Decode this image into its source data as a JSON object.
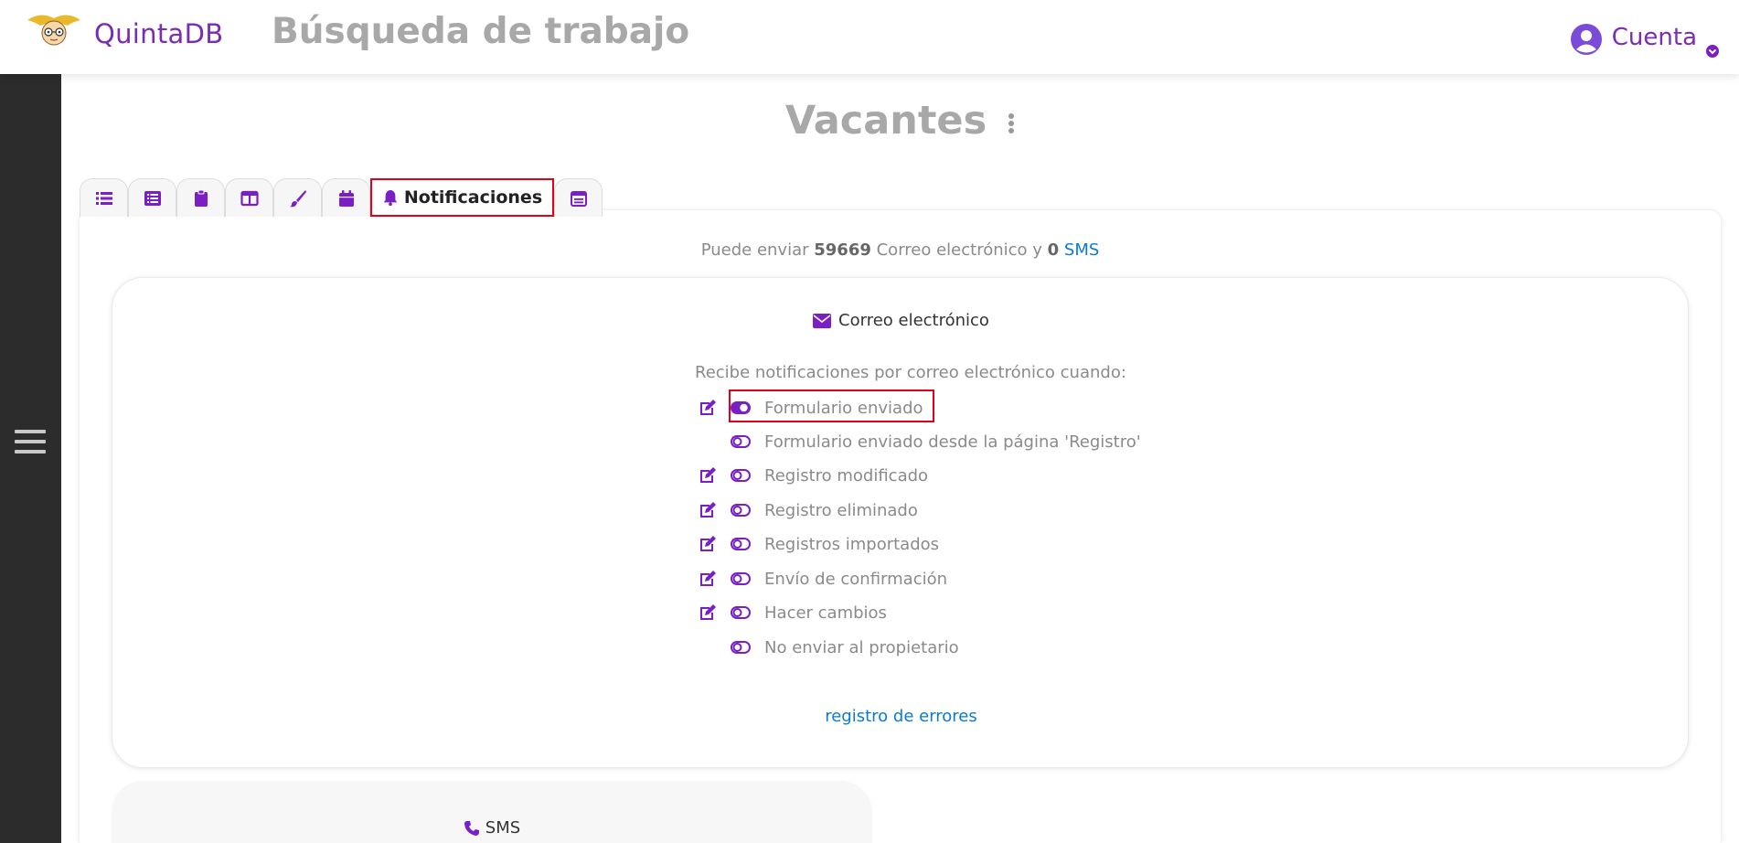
{
  "header": {
    "brand": "QuintaDB",
    "page_title": "Búsqueda de trabajo",
    "account_label": "Cuenta"
  },
  "section": {
    "title": "Vacantes"
  },
  "tabs": [
    {
      "icon": "list-icon"
    },
    {
      "icon": "form-icon"
    },
    {
      "icon": "clipboard-icon"
    },
    {
      "icon": "columns-icon"
    },
    {
      "icon": "brush-icon"
    },
    {
      "icon": "calendar-icon"
    },
    {
      "icon": "bell-icon",
      "label": "Notificaciones",
      "active": true
    },
    {
      "icon": "calendar-check-icon"
    }
  ],
  "limits": {
    "prefix": "Puede enviar",
    "email_count": "59669",
    "middle": "Correo electrónico y",
    "sms_count": "0",
    "sms_link": "SMS"
  },
  "email_card": {
    "title": "Correo electrónico",
    "intro": "Recibe notificaciones por correo electrónico cuando:",
    "items": [
      {
        "label": "Formulario enviado",
        "editable": true,
        "enabled": true
      },
      {
        "label": "Formulario enviado desde la página 'Registro'",
        "editable": false,
        "enabled": false
      },
      {
        "label": "Registro modificado",
        "editable": true,
        "enabled": false
      },
      {
        "label": "Registro eliminado",
        "editable": true,
        "enabled": false
      },
      {
        "label": "Registros importados",
        "editable": true,
        "enabled": false
      },
      {
        "label": "Envío de confirmación",
        "editable": true,
        "enabled": false
      },
      {
        "label": "Hacer cambios",
        "editable": true,
        "enabled": false
      },
      {
        "label": "No enviar al propietario",
        "editable": false,
        "enabled": false
      }
    ],
    "error_log_link": "registro de errores"
  },
  "sms_card": {
    "title": "SMS"
  },
  "colors": {
    "accent": "#7a1fc4",
    "highlight": "#e3001b",
    "link": "#0a7ad6",
    "sidebar": "#2c2c2c"
  }
}
